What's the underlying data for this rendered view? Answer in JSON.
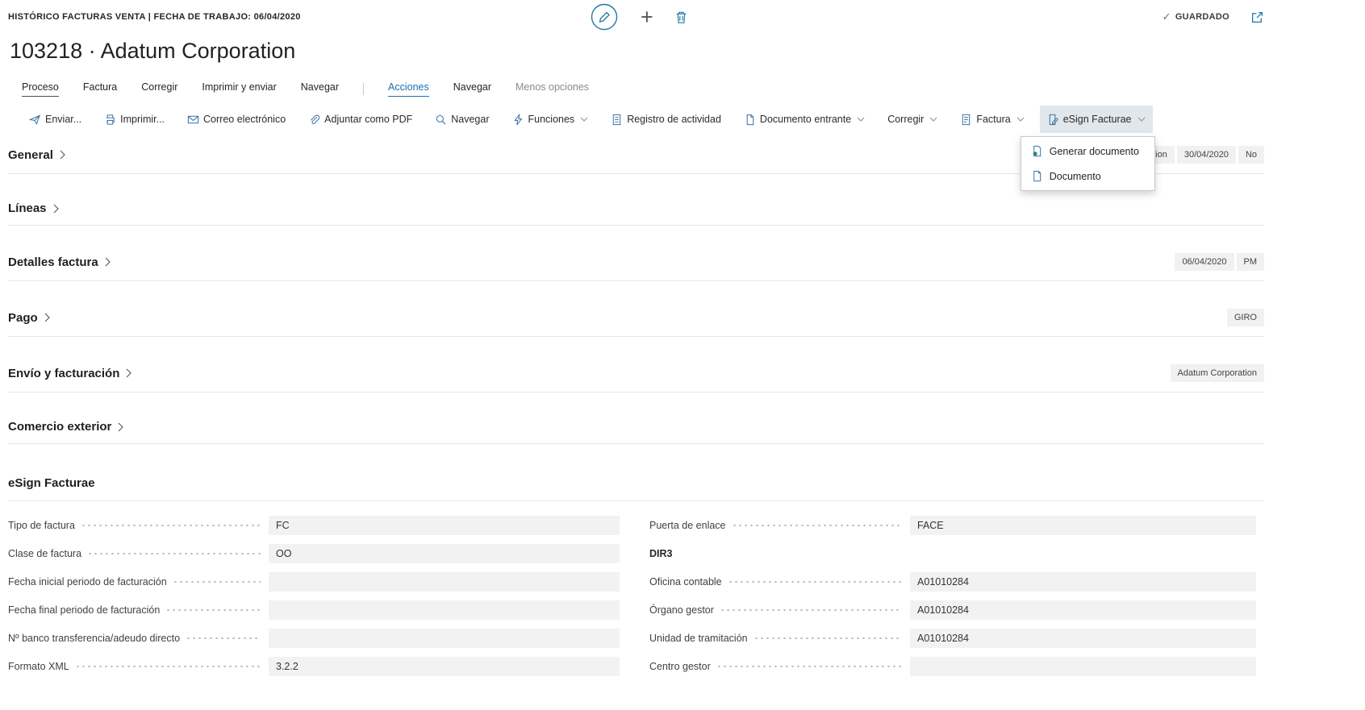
{
  "topbar": {
    "breadcrumb": "HISTÓRICO FACTURAS VENTA | FECHA DE TRABAJO: 06/04/2020",
    "saved": "GUARDADO"
  },
  "page": {
    "title": "103218 · Adatum Corporation"
  },
  "tabs": {
    "items": [
      {
        "label": "Proceso"
      },
      {
        "label": "Factura"
      },
      {
        "label": "Corregir"
      },
      {
        "label": "Imprimir y enviar"
      },
      {
        "label": "Navegar"
      },
      {
        "label": "Acciones"
      },
      {
        "label": "Navegar"
      },
      {
        "label": "Menos opciones"
      }
    ]
  },
  "toolbar": {
    "items": [
      {
        "label": "Enviar..."
      },
      {
        "label": "Imprimir..."
      },
      {
        "label": "Correo electrónico"
      },
      {
        "label": "Adjuntar como PDF"
      },
      {
        "label": "Navegar"
      },
      {
        "label": "Funciones"
      },
      {
        "label": "Registro de actividad"
      },
      {
        "label": "Documento entrante"
      },
      {
        "label": "Corregir"
      },
      {
        "label": "Factura"
      },
      {
        "label": "eSign Facturae"
      }
    ]
  },
  "dropdown": {
    "items": [
      {
        "label": "Generar documento"
      },
      {
        "label": "Documento"
      }
    ]
  },
  "sections": {
    "general": {
      "label": "General",
      "badges": [
        "Adatum Corporation",
        "30/04/2020",
        "No"
      ]
    },
    "lineas": {
      "label": "Líneas"
    },
    "detalles": {
      "label": "Detalles factura",
      "badges": [
        "06/04/2020",
        "PM"
      ]
    },
    "pago": {
      "label": "Pago",
      "badges": [
        "GIRO"
      ]
    },
    "envio": {
      "label": "Envío y facturación",
      "badges": [
        "Adatum Corporation"
      ]
    },
    "comercio": {
      "label": "Comercio exterior"
    }
  },
  "esign": {
    "title": "eSign Facturae",
    "left": [
      {
        "label": "Tipo de factura",
        "value": "FC"
      },
      {
        "label": "Clase de factura",
        "value": "OO"
      },
      {
        "label": "Fecha inicial periodo de facturación",
        "value": ""
      },
      {
        "label": "Fecha final periodo de facturación",
        "value": ""
      },
      {
        "label": "Nº banco transferencia/adeudo directo",
        "value": ""
      },
      {
        "label": "Formato XML",
        "value": "3.2.2"
      }
    ],
    "right": {
      "puerta": {
        "label": "Puerta de enlace",
        "value": "FACE"
      },
      "dir3": "DIR3",
      "fields": [
        {
          "label": "Oficina contable",
          "value": "A01010284"
        },
        {
          "label": "Órgano gestor",
          "value": "A01010284"
        },
        {
          "label": "Unidad de tramitación",
          "value": "A01010284"
        },
        {
          "label": "Centro gestor",
          "value": ""
        }
      ]
    }
  },
  "colors": {
    "accent": "#1a6fb5",
    "icon_blue": "#3f74a3",
    "teal_icon": "#2079a8",
    "field_background": "#f2f2f2",
    "badge_background": "#f1f1f1",
    "active_button_background": "#e2e7ec"
  }
}
